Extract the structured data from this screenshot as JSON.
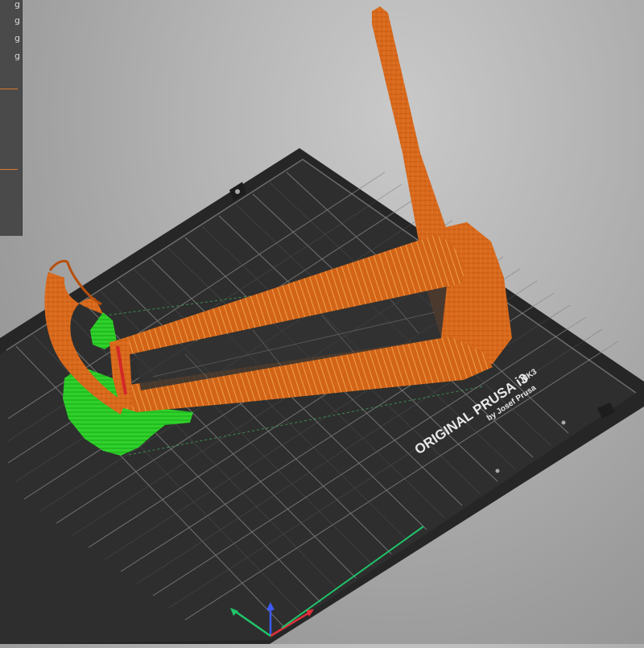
{
  "legend": {
    "rows": [
      "g",
      "g",
      "g",
      "g"
    ]
  },
  "bed": {
    "title": "ORIGINAL PRUSA i3",
    "model": "MK3",
    "maker": "by Josef Prusa"
  },
  "colors": {
    "background": "#a6a6a6",
    "panel": "#4a4a4a",
    "bed": "#2c2c2c",
    "grid": "#8e8e8e",
    "part": "#d9691c",
    "support": "#2fd12a",
    "axis_x": "#e0303a",
    "axis_y": "#20c46a",
    "axis_z": "#3b5bff",
    "legend_accent": "#e37a2a"
  },
  "icons": [
    "axes-gizmo-icon"
  ]
}
